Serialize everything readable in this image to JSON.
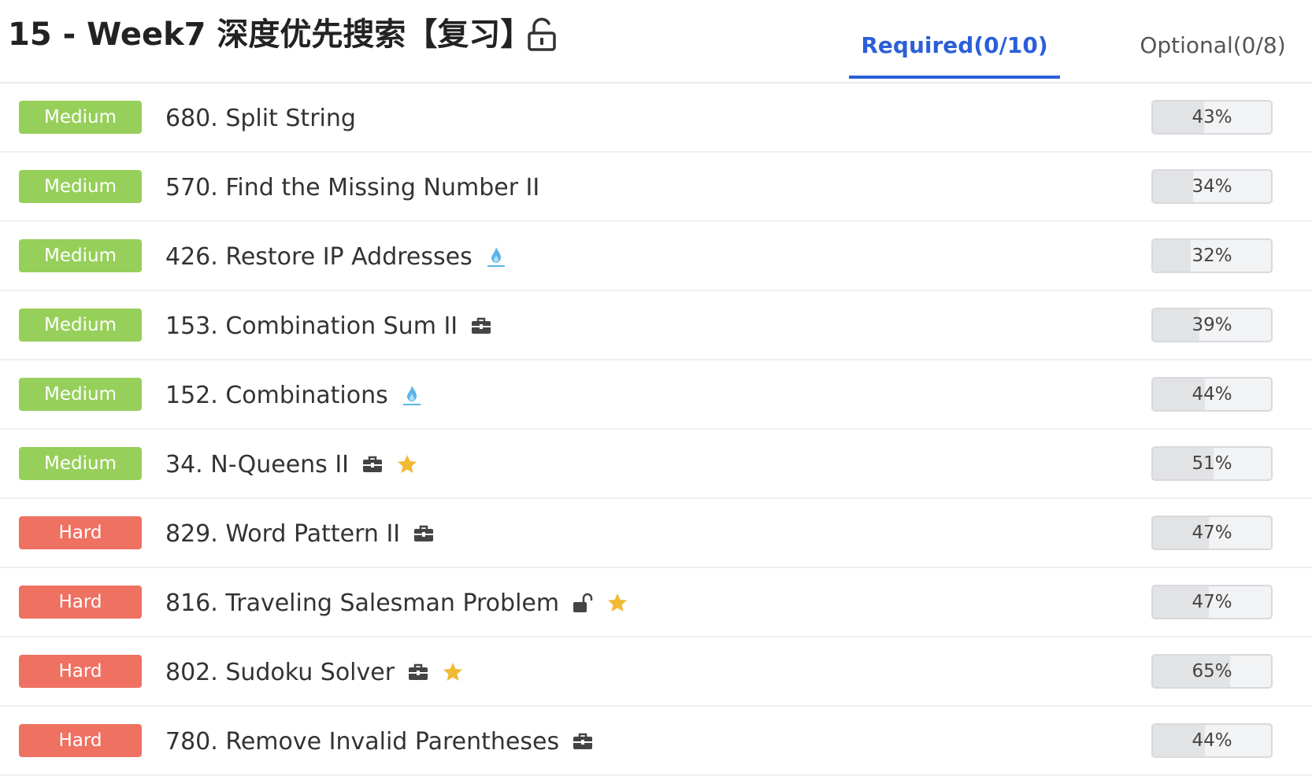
{
  "header": {
    "title": "15 - Week7 深度优先搜索【复习】",
    "lock_icon": "unlock-icon",
    "tabs": [
      {
        "label": "Required(0/10)",
        "active": true
      },
      {
        "label": "Optional(0/8)",
        "active": false
      }
    ]
  },
  "colors": {
    "medium": "#96cf5a",
    "hard": "#ee7162",
    "accent": "#2b5fd9",
    "star": "#f2b934",
    "fire": "#5ab4e8"
  },
  "problems": [
    {
      "difficulty": "Medium",
      "title": "680. Split String",
      "rate": "43%",
      "rate_value": 43,
      "icons": []
    },
    {
      "difficulty": "Medium",
      "title": "570. Find the Missing Number II",
      "rate": "34%",
      "rate_value": 34,
      "icons": []
    },
    {
      "difficulty": "Medium",
      "title": "426. Restore IP Addresses",
      "rate": "32%",
      "rate_value": 32,
      "icons": [
        "fire-icon"
      ]
    },
    {
      "difficulty": "Medium",
      "title": "153. Combination Sum II",
      "rate": "39%",
      "rate_value": 39,
      "icons": [
        "briefcase-icon"
      ]
    },
    {
      "difficulty": "Medium",
      "title": "152. Combinations",
      "rate": "44%",
      "rate_value": 44,
      "icons": [
        "fire-icon"
      ]
    },
    {
      "difficulty": "Medium",
      "title": "34. N-Queens II",
      "rate": "51%",
      "rate_value": 51,
      "icons": [
        "briefcase-icon",
        "star-icon"
      ]
    },
    {
      "difficulty": "Hard",
      "title": "829. Word Pattern II",
      "rate": "47%",
      "rate_value": 47,
      "icons": [
        "briefcase-icon"
      ]
    },
    {
      "difficulty": "Hard",
      "title": "816. Traveling Salesman Problem",
      "rate": "47%",
      "rate_value": 47,
      "icons": [
        "unlock-icon",
        "star-icon"
      ]
    },
    {
      "difficulty": "Hard",
      "title": "802. Sudoku Solver",
      "rate": "65%",
      "rate_value": 65,
      "icons": [
        "briefcase-icon",
        "star-icon"
      ]
    },
    {
      "difficulty": "Hard",
      "title": "780. Remove Invalid Parentheses",
      "rate": "44%",
      "rate_value": 44,
      "icons": [
        "briefcase-icon"
      ]
    }
  ]
}
